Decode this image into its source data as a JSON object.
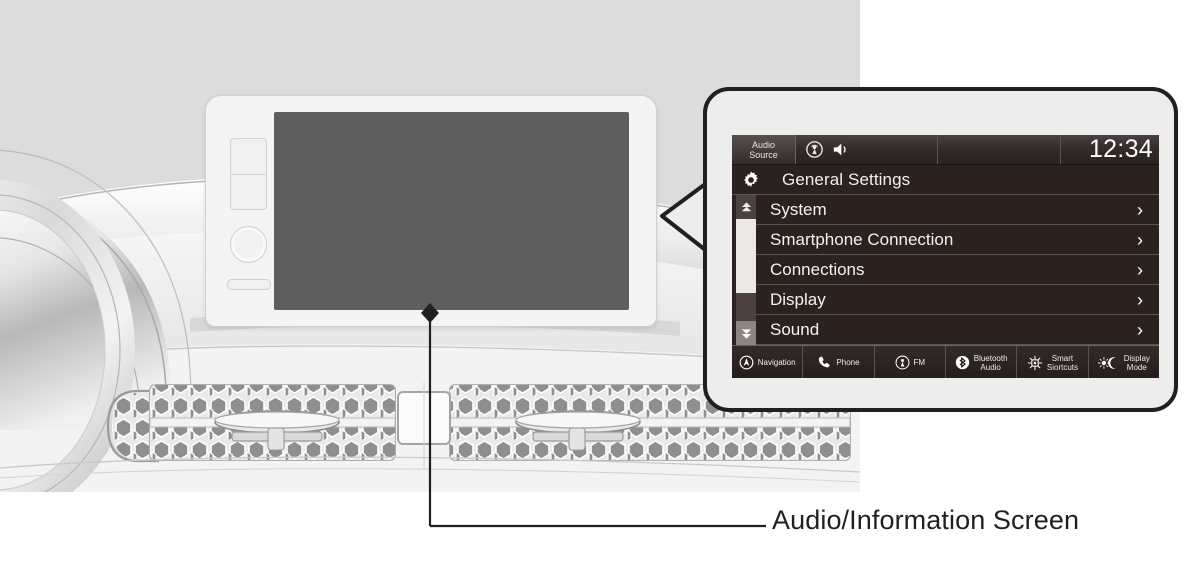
{
  "page": {
    "caption": "Audio/Information Screen",
    "bg_color": "#ffffff",
    "illustration_bg": "#dcdcdc",
    "callout_border_color": "#231f20"
  },
  "head_unit": {
    "name": "in-dash audio/information display unit",
    "screen_color": "#5e5e5e",
    "buttons": [
      "rect-button",
      "rotary-knob",
      "pill-button"
    ]
  },
  "screen": {
    "status_bar": {
      "audio_source_line1": "Audio",
      "audio_source_line2": "Source",
      "icons": [
        "radio-antenna-icon",
        "speaker-icon"
      ],
      "clock": "12:34"
    },
    "title": {
      "icon": "gear-icon",
      "label": "General Settings"
    },
    "scrollbar": {
      "up_arrow": "scroll-up-arrow-icon",
      "down_arrow": "scroll-down-arrow-icon"
    },
    "menu_items": [
      {
        "label": "System",
        "chevron": "›"
      },
      {
        "label": "Smartphone Connection",
        "chevron": "›"
      },
      {
        "label": "Connections",
        "chevron": "›"
      },
      {
        "label": "Display",
        "chevron": "›"
      },
      {
        "label": "Sound",
        "chevron": "›"
      }
    ],
    "toolbar": [
      {
        "label": "Navigation",
        "icon": "navigation-compass-icon"
      },
      {
        "label": "Phone",
        "icon": "phone-handset-icon"
      },
      {
        "label": "FM",
        "icon": "radio-antenna-icon"
      },
      {
        "label": "Bluetooth\nAudio",
        "icon": "bluetooth-icon"
      },
      {
        "label": "Smart\nSiortcuts",
        "icon": "smart-shortcuts-icon"
      },
      {
        "label": "Display\nMode",
        "icon": "sun-moon-icon"
      }
    ]
  }
}
